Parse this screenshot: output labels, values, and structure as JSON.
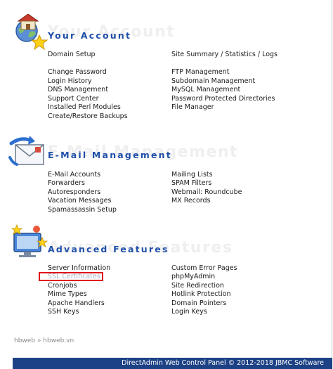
{
  "account": {
    "title": "Your Account",
    "left": [
      "Domain Setup",
      "Change Password",
      "Login History",
      "DNS Management",
      "Support Center",
      "Installed Perl Modules",
      "Create/Restore Backups"
    ],
    "right": [
      "Site Summary / Statistics / Logs",
      "FTP Management",
      "Subdomain Management",
      "MySQL Management",
      "Password Protected Directories",
      "File Manager"
    ]
  },
  "email": {
    "title": "E-Mail Management",
    "left": [
      "E-Mail Accounts",
      "Forwarders",
      "Autoresponders",
      "Vacation Messages",
      "Spamassassin Setup"
    ],
    "right": [
      "Mailing Lists",
      "SPAM Filters",
      "Webmail: Roundcube",
      "MX Records"
    ]
  },
  "advanced": {
    "title": "Advanced Features",
    "left": [
      "Server Information",
      "SSL Certificates",
      "Cronjobs",
      "Mime Types",
      "Apache Handlers",
      "SSH Keys"
    ],
    "right": [
      "Custom Error Pages",
      "phpMyAdmin",
      "Site Redirection",
      "Hotlink Protection",
      "Domain Pointers",
      "Login Keys"
    ]
  },
  "footer": {
    "crumb_user": "hbweb",
    "crumb_sep": "»",
    "crumb_domain": "hbweb.vn",
    "copyright": "DirectAdmin Web Control Panel © 2012-2018 JBMC Software"
  },
  "colors": {
    "title": "#1f4fa8",
    "bar": "#1d4185",
    "highlight": "#e0141b"
  }
}
